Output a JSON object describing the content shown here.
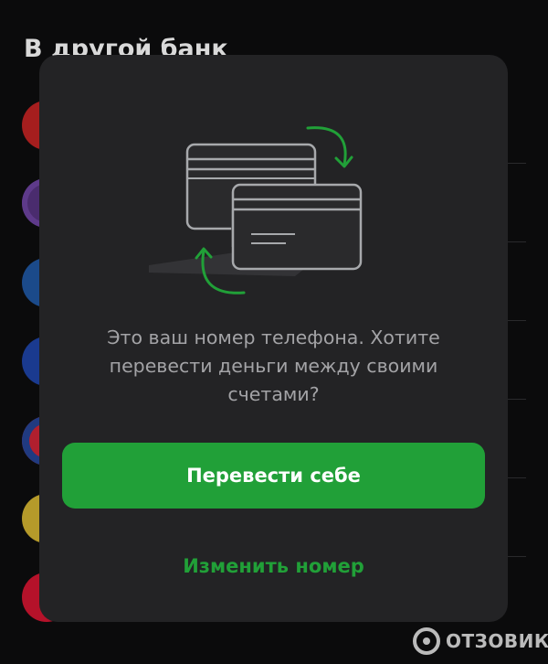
{
  "background": {
    "section_title": "В другой банк",
    "bank_icon_colors": [
      "#a51e1e",
      "#4a2c6e",
      "#1b4a8a",
      "#1a3a8f",
      "#b01f2e",
      "#b59a2a",
      "#b5122a"
    ]
  },
  "modal": {
    "message": "Это ваш номер телефона. Хотите перевести деньги между своими счетами?",
    "primary_button_label": "Перевести себе",
    "secondary_button_label": "Изменить номер"
  },
  "illustration": {
    "icon": "cards-transfer-icon"
  },
  "colors": {
    "accent": "#21a038",
    "modal_bg": "#232325",
    "page_bg": "#0b0b0c"
  },
  "watermark": {
    "text": "ОТЗОВИК"
  }
}
